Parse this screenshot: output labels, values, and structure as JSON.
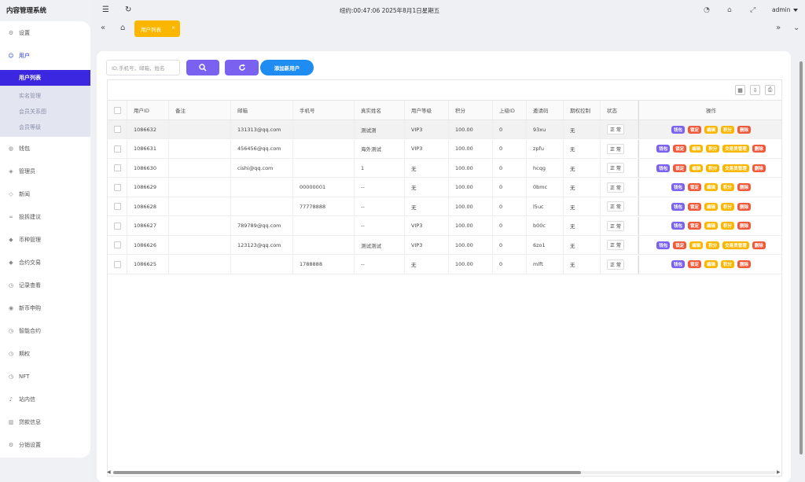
{
  "app": {
    "title": "内容管理系统"
  },
  "sidebar": {
    "items": [
      {
        "label": "设置",
        "icon": "gear-icon"
      },
      {
        "label": "用户",
        "icon": "user-icon",
        "open": true,
        "children": [
          {
            "label": "用户列表",
            "active": true
          },
          {
            "label": "实名管理"
          },
          {
            "label": "会员关系图"
          },
          {
            "label": "会员等级"
          }
        ]
      },
      {
        "label": "钱包",
        "icon": "wallet-icon"
      },
      {
        "label": "管理员",
        "icon": "shield-icon"
      },
      {
        "label": "新闻",
        "icon": "tag-icon"
      },
      {
        "label": "投拆建议",
        "icon": "link-icon"
      },
      {
        "label": "币种管理",
        "icon": "diamond-icon"
      },
      {
        "label": "合约交易",
        "icon": "diamond-icon"
      },
      {
        "label": "记录查看",
        "icon": "clock-icon"
      },
      {
        "label": "新币申购",
        "icon": "coin-icon"
      },
      {
        "label": "智能合约",
        "icon": "clock-icon"
      },
      {
        "label": "期权",
        "icon": "clock-icon"
      },
      {
        "label": "NFT",
        "icon": "clock-icon"
      },
      {
        "label": "站内信",
        "icon": "bell-icon"
      },
      {
        "label": "贷款信息",
        "icon": "bank-icon"
      },
      {
        "label": "分销设置",
        "icon": "gear-icon"
      }
    ]
  },
  "topbar": {
    "clock": "纽约:00:47:06 2025年8月1日星期五",
    "user": "admin"
  },
  "tabs": [
    {
      "label": "用户列表"
    }
  ],
  "search": {
    "placeholder": "ID,手机号，邮箱，姓名"
  },
  "buttons": {
    "add_user": "添加新用户"
  },
  "table": {
    "columns": [
      "用户ID",
      "备注",
      "邮箱",
      "手机号",
      "真实姓名",
      "用户等级",
      "积分",
      "上级ID",
      "邀请码",
      "期权控制",
      "状态",
      "操作"
    ],
    "rows": [
      {
        "id": "1086632",
        "note": "",
        "email": "131313@qq.com",
        "phone": "",
        "name": "测试测",
        "level": "VIP3",
        "points": "100.00",
        "parent": "0",
        "code": "93xu",
        "option": "无",
        "status": "正 常",
        "ops": [
          "钱包",
          "锁定",
          "编辑",
          "积分",
          "删除"
        ]
      },
      {
        "id": "1086631",
        "note": "",
        "email": "456456@qq.com",
        "phone": "",
        "name": "海外测试",
        "level": "VIP3",
        "points": "100.00",
        "parent": "0",
        "code": "zpfu",
        "option": "无",
        "status": "正 常",
        "ops": [
          "钱包",
          "锁定",
          "编辑",
          "积分",
          "交易员管理",
          "删除"
        ]
      },
      {
        "id": "1086630",
        "note": "",
        "email": "cishi@qq.com",
        "phone": "",
        "name": "1",
        "level": "无",
        "points": "100.00",
        "parent": "0",
        "code": "hcqg",
        "option": "无",
        "status": "正 常",
        "ops": [
          "钱包",
          "锁定",
          "编辑",
          "积分",
          "交易员管理",
          "删除"
        ]
      },
      {
        "id": "1086629",
        "note": "",
        "email": "",
        "phone": "00000001",
        "name": "--",
        "level": "无",
        "points": "100.00",
        "parent": "0",
        "code": "0bmc",
        "option": "无",
        "status": "正 常",
        "ops": [
          "钱包",
          "锁定",
          "编辑",
          "积分",
          "删除"
        ]
      },
      {
        "id": "1086628",
        "note": "",
        "email": "",
        "phone": "77778888",
        "name": "--",
        "level": "无",
        "points": "100.00",
        "parent": "0",
        "code": "l5uc",
        "option": "无",
        "status": "正 常",
        "ops": [
          "钱包",
          "锁定",
          "编辑",
          "积分",
          "删除"
        ]
      },
      {
        "id": "1086627",
        "note": "",
        "email": "789789@qq.com",
        "phone": "",
        "name": "--",
        "level": "VIP3",
        "points": "100.00",
        "parent": "0",
        "code": "b00c",
        "option": "无",
        "status": "正 常",
        "ops": [
          "钱包",
          "锁定",
          "编辑",
          "积分",
          "删除"
        ]
      },
      {
        "id": "1086626",
        "note": "",
        "email": "123123@qq.com",
        "phone": "",
        "name": "测试测试",
        "level": "VIP3",
        "points": "100.00",
        "parent": "0",
        "code": "6zo1",
        "option": "无",
        "status": "正 常",
        "ops": [
          "钱包",
          "锁定",
          "编辑",
          "积分",
          "交易员管理",
          "删除"
        ]
      },
      {
        "id": "1086625",
        "note": "",
        "email": "",
        "phone": "1788888",
        "name": "--",
        "level": "无",
        "points": "100.00",
        "parent": "0",
        "code": "mlft",
        "option": "无",
        "status": "正 常",
        "ops": [
          "钱包",
          "锁定",
          "编辑",
          "积分",
          "删除"
        ]
      }
    ]
  },
  "colors": {
    "brand_purple": "#3b27e0",
    "button_purple": "#7b61f0",
    "accent_blue": "#1e8cf0",
    "tab_yellow": "#fbb700",
    "danger": "#f05a3b"
  }
}
